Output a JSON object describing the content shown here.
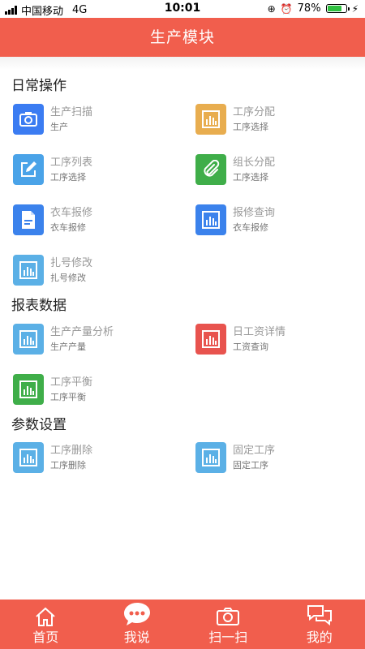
{
  "status_bar": {
    "carrier": "中国移动",
    "network": "4G",
    "time": "10:01",
    "battery": "78%"
  },
  "header": {
    "title": "生产模块"
  },
  "sections": [
    {
      "title": "日常操作",
      "items": [
        {
          "title": "生产扫描",
          "sub": "生产",
          "icon": "camera-icon",
          "color": "#3b7cf2"
        },
        {
          "title": "工序分配",
          "sub": "工序选择",
          "icon": "bar-chart-icon",
          "color": "#e8ad4f"
        },
        {
          "title": "工序列表",
          "sub": "工序选择",
          "icon": "edit-icon",
          "color": "#4aa3e8"
        },
        {
          "title": "组长分配",
          "sub": "工序选择",
          "icon": "paperclip-icon",
          "color": "#3fae49"
        },
        {
          "title": "衣车报修",
          "sub": "衣车报修",
          "icon": "document-icon",
          "color": "#3b82ec"
        },
        {
          "title": "报修查询",
          "sub": "衣车报修",
          "icon": "bar-chart-icon",
          "color": "#3b82ec"
        },
        {
          "title": "扎号修改",
          "sub": "扎号修改",
          "icon": "bar-chart-icon",
          "color": "#5bb0e6"
        }
      ]
    },
    {
      "title": "报表数据",
      "items": [
        {
          "title": "生产产量分析",
          "sub": "生产产量",
          "icon": "bar-chart-icon",
          "color": "#5bb0e6"
        },
        {
          "title": "日工资详情",
          "sub": "工资查询",
          "icon": "bar-chart-icon",
          "color": "#e8534e"
        },
        {
          "title": "工序平衡",
          "sub": "工序平衡",
          "icon": "bar-chart-icon",
          "color": "#3fae49"
        }
      ]
    },
    {
      "title": "参数设置",
      "items": [
        {
          "title": "工序删除",
          "sub": "工序删除",
          "icon": "bar-chart-icon",
          "color": "#5bb0e6"
        },
        {
          "title": "固定工序",
          "sub": "固定工序",
          "icon": "bar-chart-icon",
          "color": "#5bb0e6"
        }
      ]
    }
  ],
  "nav": [
    {
      "label": "首页",
      "icon": "home-icon"
    },
    {
      "label": "我说",
      "icon": "chat-bubble-icon"
    },
    {
      "label": "扫一扫",
      "icon": "camera-icon"
    },
    {
      "label": "我的",
      "icon": "messages-icon"
    }
  ]
}
